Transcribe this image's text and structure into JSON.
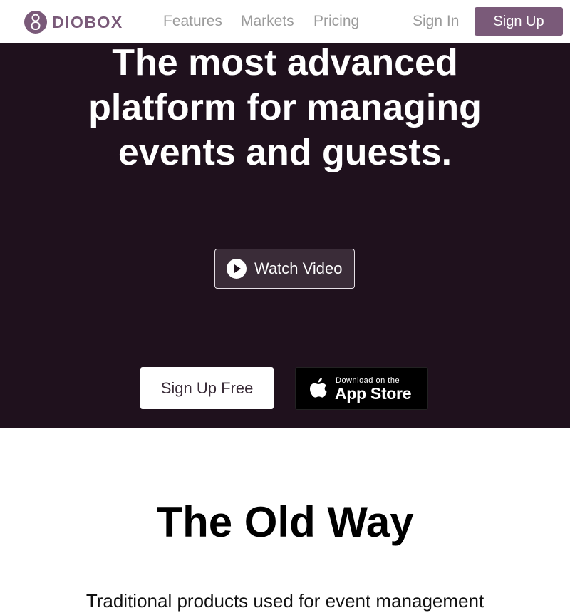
{
  "nav": {
    "brand": "DIOBOX",
    "links": [
      "Features",
      "Markets",
      "Pricing"
    ],
    "signin": "Sign In",
    "signup": "Sign Up"
  },
  "hero": {
    "title_lines": [
      "The most advanced",
      "platform for managing",
      "events and guests."
    ],
    "watch_video": "Watch Video",
    "signup_free": "Sign Up Free",
    "appstore": {
      "small": "Download on the",
      "large": "App Store"
    }
  },
  "section": {
    "title": "The Old Way",
    "subtitle": "Traditional products used for event management"
  },
  "colors": {
    "brand": "#7a5a79",
    "hero_bg": "#1f111d",
    "nav_text": "#9b9b9b"
  },
  "icons": {
    "logo": "diobox-logo-icon",
    "play": "play-icon",
    "apple": "apple-icon"
  }
}
